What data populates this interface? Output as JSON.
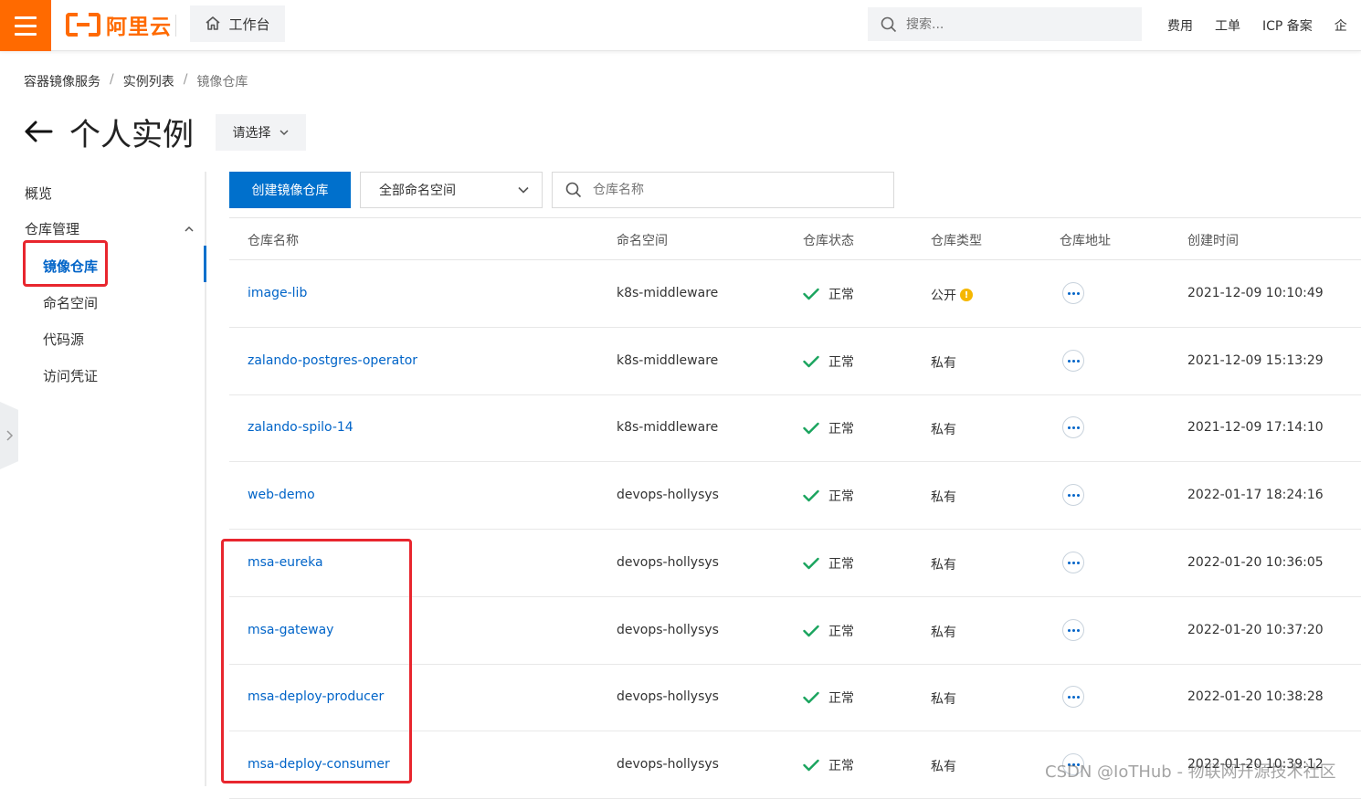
{
  "topbar": {
    "logo_text": "阿里云",
    "workbench_label": "工作台",
    "search_placeholder": "搜索...",
    "links": [
      "费用",
      "工单",
      "ICP 备案",
      "企"
    ]
  },
  "breadcrumb": [
    "容器镜像服务",
    "实例列表",
    "镜像仓库"
  ],
  "header": {
    "title": "个人实例",
    "select_label": "请选择"
  },
  "sidebar": {
    "overview": "概览",
    "group_label": "仓库管理",
    "items": [
      "镜像仓库",
      "命名空间",
      "代码源",
      "访问凭证"
    ]
  },
  "toolbar": {
    "create_label": "创建镜像仓库",
    "namespace_select": "全部命名空间",
    "search_placeholder": "仓库名称"
  },
  "table": {
    "columns": [
      "仓库名称",
      "命名空间",
      "仓库状态",
      "仓库类型",
      "仓库地址",
      "创建时间"
    ],
    "rows": [
      {
        "name": "image-lib",
        "namespace": "k8s-middleware",
        "status": "正常",
        "type": "公开",
        "created": "2021-12-09 10:10:49"
      },
      {
        "name": "zalando-postgres-operator",
        "namespace": "k8s-middleware",
        "status": "正常",
        "type": "私有",
        "created": "2021-12-09 15:13:29"
      },
      {
        "name": "zalando-spilo-14",
        "namespace": "k8s-middleware",
        "status": "正常",
        "type": "私有",
        "created": "2021-12-09 17:14:10"
      },
      {
        "name": "web-demo",
        "namespace": "devops-hollysys",
        "status": "正常",
        "type": "私有",
        "created": "2022-01-17 18:24:16"
      },
      {
        "name": "msa-eureka",
        "namespace": "devops-hollysys",
        "status": "正常",
        "type": "私有",
        "created": "2022-01-20 10:36:05"
      },
      {
        "name": "msa-gateway",
        "namespace": "devops-hollysys",
        "status": "正常",
        "type": "私有",
        "created": "2022-01-20 10:37:20"
      },
      {
        "name": "msa-deploy-producer",
        "namespace": "devops-hollysys",
        "status": "正常",
        "type": "私有",
        "created": "2022-01-20 10:38:28"
      },
      {
        "name": "msa-deploy-consumer",
        "namespace": "devops-hollysys",
        "status": "正常",
        "type": "私有",
        "created": "2022-01-20 10:39:12"
      }
    ]
  },
  "watermark": "CSDN @IoTHub - 物联网开源技术社区",
  "colors": {
    "brand": "#ff6a00",
    "primary": "#0070cc",
    "link": "#0064c8",
    "success": "#1aa45e",
    "highlight": "#e8262e"
  }
}
